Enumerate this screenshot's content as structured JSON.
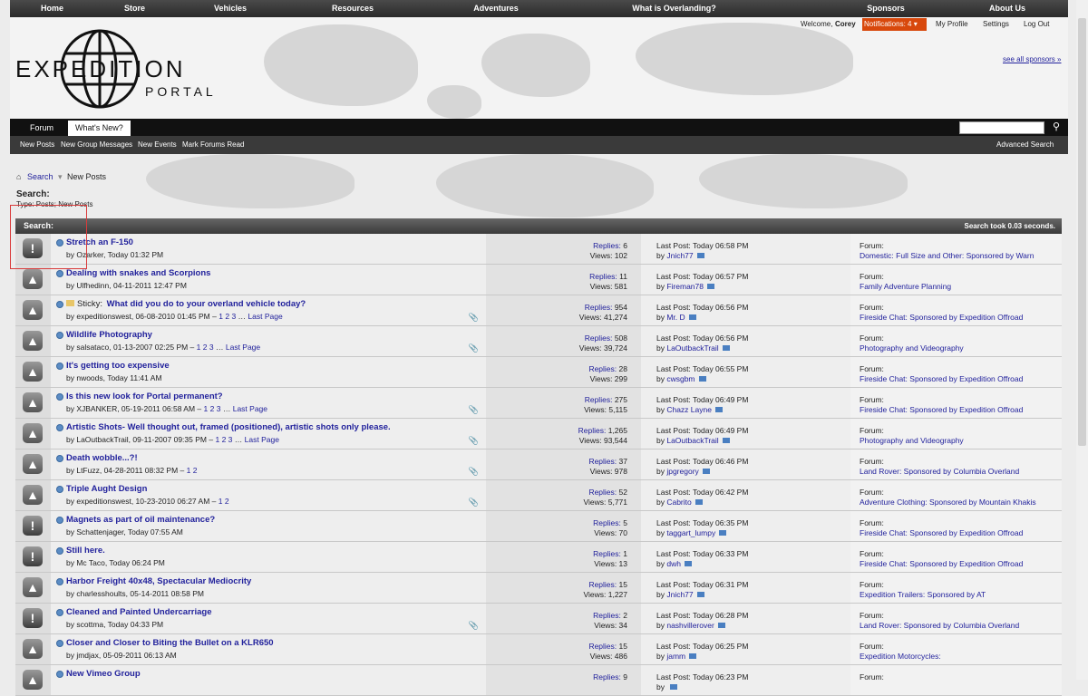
{
  "topnav": [
    "Home",
    "Store",
    "Vehicles",
    "Resources",
    "Adventures",
    "What is Overlanding?",
    "Sponsors",
    "About Us"
  ],
  "logo": {
    "word1": "EXPEDITION",
    "word2": "PORTAL"
  },
  "user": {
    "welcome": "Welcome,",
    "name": "Corey",
    "notifications": "Notifications: 4",
    "profile": "My Profile",
    "settings": "Settings",
    "logout": "Log Out"
  },
  "sponsors_link": "see all sponsors »",
  "navbar": {
    "tabs": [
      "Forum",
      "What's New?"
    ],
    "active": "What's New?"
  },
  "subnav": {
    "links": [
      "New Posts",
      "New Group Messages",
      "New Events",
      "Mark Forums Read"
    ],
    "advanced": "Advanced Search"
  },
  "breadcrumb": {
    "search": "Search",
    "current": "New Posts"
  },
  "search": {
    "title": "Search:",
    "type": "Type: Posts; New Posts"
  },
  "table_header": {
    "label": "Search:",
    "time": "Search took 0.03 seconds."
  },
  "threads": [
    {
      "icon": "alert",
      "title": "Stretch an F-150",
      "meta": "by Ozarker, Today 01:32 PM",
      "sticky": false,
      "pages": [],
      "last_page": "",
      "clip": false,
      "replies_label": "Replies:",
      "replies": "6",
      "views": "Views: 102",
      "last_label": "Last Post: Today 06:58 PM",
      "last_by": "Jnich77",
      "forum_label": "Forum:",
      "forum": "Domestic: Full Size and Other: Sponsored by Warn"
    },
    {
      "icon": "hot",
      "title": "Dealing with snakes and Scorpions",
      "meta": "by Ulfhedinn, 04-11-2011 12:47 PM",
      "sticky": false,
      "pages": [],
      "last_page": "",
      "clip": false,
      "replies_label": "Replies:",
      "replies": "11",
      "views": "Views: 581",
      "last_label": "Last Post: Today 06:57 PM",
      "last_by": "Fireman78",
      "forum_label": "Forum:",
      "forum": "Family Adventure Planning"
    },
    {
      "icon": "hot",
      "title": "What did you do to your overland vehicle today?",
      "meta": "by expeditionswest, 06-08-2010 01:45 PM –",
      "sticky": true,
      "pages": [
        "1",
        "2",
        "3"
      ],
      "last_page": "Last Page",
      "clip": true,
      "replies_label": "Replies:",
      "replies": "954",
      "views": "Views: 41,274",
      "last_label": "Last Post: Today 06:56 PM",
      "last_by": "Mr. D",
      "forum_label": "Forum:",
      "forum": "Fireside Chat: Sponsored by Expedition Offroad"
    },
    {
      "icon": "hot",
      "title": "Wildlife Photography",
      "meta": "by salsataco, 01-13-2007 02:25 PM –",
      "sticky": false,
      "pages": [
        "1",
        "2",
        "3"
      ],
      "last_page": "Last Page",
      "clip": true,
      "replies_label": "Replies:",
      "replies": "508",
      "views": "Views: 39,724",
      "last_label": "Last Post: Today 06:56 PM",
      "last_by": "LaOutbackTrail",
      "forum_label": "Forum:",
      "forum": "Photography and Videography"
    },
    {
      "icon": "hot",
      "title": "It's getting too expensive",
      "meta": "by nwoods, Today 11:41 AM",
      "sticky": false,
      "pages": [],
      "last_page": "",
      "clip": false,
      "replies_label": "Replies:",
      "replies": "28",
      "views": "Views: 299",
      "last_label": "Last Post: Today 06:55 PM",
      "last_by": "cwsgbm",
      "forum_label": "Forum:",
      "forum": "Fireside Chat: Sponsored by Expedition Offroad"
    },
    {
      "icon": "hot",
      "title": "Is this new look for Portal permanent?",
      "meta": "by XJBANKER, 05-19-2011 06:58 AM –",
      "sticky": false,
      "pages": [
        "1",
        "2",
        "3"
      ],
      "last_page": "Last Page",
      "clip": true,
      "replies_label": "Replies:",
      "replies": "275",
      "views": "Views: 5,115",
      "last_label": "Last Post: Today 06:49 PM",
      "last_by": "Chazz Layne",
      "forum_label": "Forum:",
      "forum": "Fireside Chat: Sponsored by Expedition Offroad"
    },
    {
      "icon": "hot",
      "title": "Artistic Shots- Well thought out, framed (positioned), artistic shots only please.",
      "meta": "by LaOutbackTrail, 09-11-2007 09:35 PM –",
      "sticky": false,
      "pages": [
        "1",
        "2",
        "3"
      ],
      "last_page": "Last Page",
      "clip": true,
      "replies_label": "Replies:",
      "replies": "1,265",
      "views": "Views: 93,544",
      "last_label": "Last Post: Today 06:49 PM",
      "last_by": "LaOutbackTrail",
      "forum_label": "Forum:",
      "forum": "Photography and Videography"
    },
    {
      "icon": "hot",
      "title": "Death wobble...?!",
      "meta": "by LtFuzz, 04-28-2011 08:32 PM –",
      "sticky": false,
      "pages": [
        "1",
        "2"
      ],
      "last_page": "",
      "clip": true,
      "replies_label": "Replies:",
      "replies": "37",
      "views": "Views: 978",
      "last_label": "Last Post: Today 06:46 PM",
      "last_by": "jpgregory",
      "forum_label": "Forum:",
      "forum": "Land Rover: Sponsored by Columbia Overland"
    },
    {
      "icon": "hot",
      "title": "Triple Aught Design",
      "meta": "by expeditionswest, 10-23-2010 06:27 AM –",
      "sticky": false,
      "pages": [
        "1",
        "2"
      ],
      "last_page": "",
      "clip": true,
      "replies_label": "Replies:",
      "replies": "52",
      "views": "Views: 5,771",
      "last_label": "Last Post: Today 06:42 PM",
      "last_by": "Cabrito",
      "forum_label": "Forum:",
      "forum": "Adventure Clothing: Sponsored by Mountain Khakis"
    },
    {
      "icon": "alert",
      "title": "Magnets as part of oil maintenance?",
      "meta": "by Schattenjager, Today 07:55 AM",
      "sticky": false,
      "pages": [],
      "last_page": "",
      "clip": false,
      "replies_label": "Replies:",
      "replies": "5",
      "views": "Views: 70",
      "last_label": "Last Post: Today 06:35 PM",
      "last_by": "taggart_lumpy",
      "forum_label": "Forum:",
      "forum": "Fireside Chat: Sponsored by Expedition Offroad"
    },
    {
      "icon": "alert",
      "title": "Still here.",
      "meta": "by Mc Taco, Today 06:24 PM",
      "sticky": false,
      "pages": [],
      "last_page": "",
      "clip": false,
      "replies_label": "Replies:",
      "replies": "1",
      "views": "Views: 13",
      "last_label": "Last Post: Today 06:33 PM",
      "last_by": "dwh",
      "forum_label": "Forum:",
      "forum": "Fireside Chat: Sponsored by Expedition Offroad"
    },
    {
      "icon": "hot",
      "title": "Harbor Freight 40x48, Spectacular Mediocrity",
      "meta": "by charlesshoults, 05-14-2011 08:58 PM",
      "sticky": false,
      "pages": [],
      "last_page": "",
      "clip": false,
      "replies_label": "Replies:",
      "replies": "15",
      "views": "Views: 1,227",
      "last_label": "Last Post: Today 06:31 PM",
      "last_by": "Jnich77",
      "forum_label": "Forum:",
      "forum": "Expedition Trailers: Sponsored by AT"
    },
    {
      "icon": "alert",
      "title": "Cleaned and Painted Undercarriage",
      "meta": "by scottma, Today 04:33 PM",
      "sticky": false,
      "pages": [],
      "last_page": "",
      "clip": true,
      "replies_label": "Replies:",
      "replies": "2",
      "views": "Views: 34",
      "last_label": "Last Post: Today 06:28 PM",
      "last_by": "nashvillerover",
      "forum_label": "Forum:",
      "forum": "Land Rover: Sponsored by Columbia Overland"
    },
    {
      "icon": "hot",
      "title": "Closer and Closer to Biting the Bullet on a KLR650",
      "meta": "by jmdjax, 05-09-2011 06:13 AM",
      "sticky": false,
      "pages": [],
      "last_page": "",
      "clip": false,
      "replies_label": "Replies:",
      "replies": "15",
      "views": "Views: 486",
      "last_label": "Last Post: Today 06:25 PM",
      "last_by": "jamm",
      "forum_label": "Forum:",
      "forum": "Expedition Motorcycles:"
    },
    {
      "icon": "hot",
      "title": "New Vimeo Group",
      "meta": "",
      "sticky": false,
      "pages": [],
      "last_page": "",
      "clip": false,
      "replies_label": "Replies:",
      "replies": "9",
      "views": "",
      "last_label": "Last Post: Today 06:23 PM",
      "last_by": "",
      "forum_label": "Forum:",
      "forum": ""
    }
  ]
}
